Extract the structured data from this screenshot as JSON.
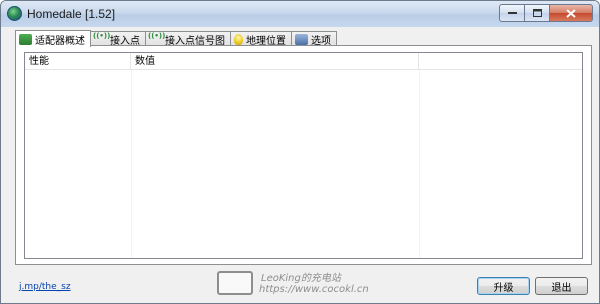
{
  "window": {
    "title": "Homedale [1.52]"
  },
  "tabs": [
    {
      "label": "适配器概述",
      "icon": "adapter-icon",
      "active": true
    },
    {
      "label": "接入点",
      "icon": "access-point-icon",
      "active": false
    },
    {
      "label": "接入点信号图",
      "icon": "signal-graph-icon",
      "active": false
    },
    {
      "label": "地理位置",
      "icon": "location-icon",
      "active": false
    },
    {
      "label": "选项",
      "icon": "options-icon",
      "active": false
    }
  ],
  "table": {
    "columns": [
      "性能",
      "数值",
      ""
    ],
    "rows": []
  },
  "footer": {
    "link": "j.mp/the_sz",
    "watermark_line1": "LeoKing的充电站",
    "watermark_line2": "https://www.cocokl.cn",
    "upgrade_label": "升级",
    "exit_label": "退出"
  }
}
